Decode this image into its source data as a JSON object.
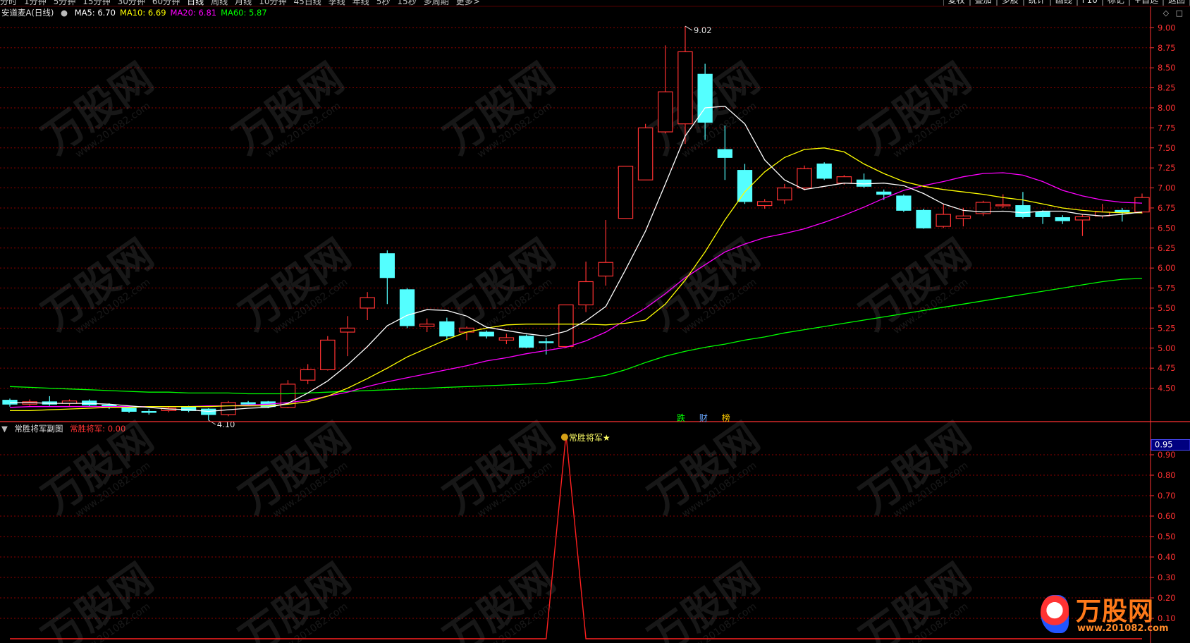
{
  "toolbar": {
    "periods": [
      "分时",
      "1分钟",
      "5分钟",
      "15分钟",
      "30分钟",
      "60分钟",
      "日线",
      "周线",
      "月线",
      "10分钟",
      "45日线",
      "季线",
      "年线",
      "5秒",
      "15秒",
      "多周期",
      "更多>"
    ],
    "active_period": "日线",
    "right_buttons": [
      "复权",
      "叠加",
      "多股",
      "统计",
      "画线",
      "F10",
      "标记",
      "+自选",
      "返回"
    ]
  },
  "main": {
    "stock_title": "安道麦A(日线)",
    "ma": [
      {
        "label": "MA5: 6.70",
        "color": "#ffffff"
      },
      {
        "label": "MA10: 6.69",
        "color": "#ffff00"
      },
      {
        "label": "MA20: 6.81",
        "color": "#ff00ff"
      },
      {
        "label": "MA60: 5.87",
        "color": "#00ff00"
      }
    ],
    "max_label": "9.02",
    "min_label": "4.10",
    "price_axis": [
      "9.00",
      "8.75",
      "8.50",
      "8.25",
      "8.00",
      "7.75",
      "7.50",
      "7.25",
      "7.00",
      "6.75",
      "6.50",
      "6.25",
      "6.00",
      "5.75",
      "5.50",
      "5.25",
      "5.00",
      "4.75",
      "4.50"
    ],
    "bottom_badges": [
      "跌",
      "财",
      "榜"
    ],
    "colors": {
      "up": "#ff3232",
      "down": "#54ffff",
      "grid": "#8b0000",
      "axis": "#ff3232"
    }
  },
  "sub": {
    "title": "常胜将军副图",
    "value_label": "常胜将军: 0.00",
    "signal_label": "常胜将军★",
    "current_value": "0.95",
    "axis": [
      "0.90",
      "0.80",
      "0.70",
      "0.60",
      "0.50",
      "0.40",
      "0.30",
      "0.20",
      "0.10"
    ]
  },
  "watermark": {
    "brand": "万股网",
    "url": "www.201082.com"
  },
  "chart_data": {
    "type": "candlestick",
    "candles": [
      {
        "o": 4.35,
        "c": 4.3,
        "h": 4.37,
        "l": 4.27
      },
      {
        "o": 4.3,
        "c": 4.33,
        "h": 4.36,
        "l": 4.28
      },
      {
        "o": 4.33,
        "c": 4.3,
        "h": 4.4,
        "l": 4.28
      },
      {
        "o": 4.31,
        "c": 4.34,
        "h": 4.36,
        "l": 4.28
      },
      {
        "o": 4.34,
        "c": 4.29,
        "h": 4.36,
        "l": 4.27
      },
      {
        "o": 4.29,
        "c": 4.26,
        "h": 4.31,
        "l": 4.24
      },
      {
        "o": 4.25,
        "c": 4.21,
        "h": 4.28,
        "l": 4.19
      },
      {
        "o": 4.21,
        "c": 4.2,
        "h": 4.24,
        "l": 4.17
      },
      {
        "o": 4.22,
        "c": 4.25,
        "h": 4.27,
        "l": 4.2
      },
      {
        "o": 4.27,
        "c": 4.22,
        "h": 4.28,
        "l": 4.2
      },
      {
        "o": 4.24,
        "c": 4.17,
        "h": 4.25,
        "l": 4.1
      },
      {
        "o": 4.17,
        "c": 4.32,
        "h": 4.34,
        "l": 4.15
      },
      {
        "o": 4.32,
        "c": 4.3,
        "h": 4.34,
        "l": 4.28
      },
      {
        "o": 4.33,
        "c": 4.27,
        "h": 4.34,
        "l": 4.25
      },
      {
        "o": 4.26,
        "c": 4.55,
        "h": 4.6,
        "l": 4.25
      },
      {
        "o": 4.6,
        "c": 4.73,
        "h": 4.8,
        "l": 4.55
      },
      {
        "o": 4.73,
        "c": 5.1,
        "h": 5.15,
        "l": 4.72
      },
      {
        "o": 5.2,
        "c": 5.25,
        "h": 5.4,
        "l": 4.9
      },
      {
        "o": 5.5,
        "c": 5.63,
        "h": 5.7,
        "l": 5.35
      },
      {
        "o": 6.18,
        "c": 5.88,
        "h": 6.22,
        "l": 5.55
      },
      {
        "o": 5.73,
        "c": 5.28,
        "h": 5.75,
        "l": 5.25
      },
      {
        "o": 5.27,
        "c": 5.3,
        "h": 5.37,
        "l": 5.2
      },
      {
        "o": 5.33,
        "c": 5.15,
        "h": 5.38,
        "l": 5.1
      },
      {
        "o": 5.2,
        "c": 5.25,
        "h": 5.27,
        "l": 5.1
      },
      {
        "o": 5.2,
        "c": 5.15,
        "h": 5.22,
        "l": 5.12
      },
      {
        "o": 5.1,
        "c": 5.13,
        "h": 5.18,
        "l": 5.05
      },
      {
        "o": 5.15,
        "c": 5.01,
        "h": 5.17,
        "l": 5.0
      },
      {
        "o": 5.08,
        "c": 5.07,
        "h": 5.13,
        "l": 4.92
      },
      {
        "o": 5.02,
        "c": 5.54,
        "h": 5.54,
        "l": 5.0
      },
      {
        "o": 5.54,
        "c": 5.83,
        "h": 6.08,
        "l": 5.45
      },
      {
        "o": 5.9,
        "c": 6.07,
        "h": 6.6,
        "l": 5.78
      },
      {
        "o": 6.62,
        "c": 7.27,
        "h": 7.27,
        "l": 6.62
      },
      {
        "o": 7.1,
        "c": 7.75,
        "h": 7.8,
        "l": 7.1
      },
      {
        "o": 7.7,
        "c": 8.2,
        "h": 8.78,
        "l": 7.68
      },
      {
        "o": 7.8,
        "c": 8.7,
        "h": 9.02,
        "l": 7.55
      },
      {
        "o": 8.42,
        "c": 7.82,
        "h": 8.55,
        "l": 7.6
      },
      {
        "o": 7.48,
        "c": 7.38,
        "h": 7.78,
        "l": 7.1
      },
      {
        "o": 7.22,
        "c": 6.83,
        "h": 7.3,
        "l": 6.8
      },
      {
        "o": 6.78,
        "c": 6.83,
        "h": 6.86,
        "l": 6.74
      },
      {
        "o": 6.85,
        "c": 7.0,
        "h": 7.05,
        "l": 6.8
      },
      {
        "o": 7.0,
        "c": 7.24,
        "h": 7.28,
        "l": 6.97
      },
      {
        "o": 7.3,
        "c": 7.12,
        "h": 7.32,
        "l": 7.1
      },
      {
        "o": 7.06,
        "c": 7.14,
        "h": 7.16,
        "l": 7.04
      },
      {
        "o": 7.1,
        "c": 7.02,
        "h": 7.18,
        "l": 7.0
      },
      {
        "o": 6.95,
        "c": 6.92,
        "h": 6.98,
        "l": 6.85
      },
      {
        "o": 6.9,
        "c": 6.72,
        "h": 6.92,
        "l": 6.7
      },
      {
        "o": 6.72,
        "c": 6.5,
        "h": 6.74,
        "l": 6.49
      },
      {
        "o": 6.52,
        "c": 6.67,
        "h": 6.8,
        "l": 6.5
      },
      {
        "o": 6.62,
        "c": 6.65,
        "h": 6.75,
        "l": 6.52
      },
      {
        "o": 6.68,
        "c": 6.82,
        "h": 6.84,
        "l": 6.65
      },
      {
        "o": 6.78,
        "c": 6.79,
        "h": 6.92,
        "l": 6.75
      },
      {
        "o": 6.78,
        "c": 6.64,
        "h": 6.95,
        "l": 6.62
      },
      {
        "o": 6.7,
        "c": 6.64,
        "h": 6.72,
        "l": 6.55
      },
      {
        "o": 6.63,
        "c": 6.59,
        "h": 6.66,
        "l": 6.55
      },
      {
        "o": 6.6,
        "c": 6.64,
        "h": 6.67,
        "l": 6.4
      },
      {
        "o": 6.65,
        "c": 6.7,
        "h": 6.8,
        "l": 6.62
      },
      {
        "o": 6.72,
        "c": 6.7,
        "h": 6.75,
        "l": 6.58
      },
      {
        "o": 6.7,
        "c": 6.88,
        "h": 6.93,
        "l": 6.68
      }
    ],
    "ma5_series": [
      4.32,
      4.32,
      4.31,
      4.31,
      4.31,
      4.3,
      4.28,
      4.26,
      4.24,
      4.23,
      4.21,
      4.23,
      4.25,
      4.26,
      4.31,
      4.44,
      4.59,
      4.79,
      5.02,
      5.28,
      5.41,
      5.48,
      5.47,
      5.4,
      5.26,
      5.22,
      5.18,
      5.15,
      5.21,
      5.34,
      5.52,
      5.98,
      6.46,
      7.05,
      7.65,
      8.0,
      8.02,
      7.8,
      7.35,
      7.1,
      6.98,
      7.02,
      7.06,
      7.05,
      7.06,
      7.03,
      6.93,
      6.8,
      6.72,
      6.7,
      6.71,
      6.69,
      6.71,
      6.71,
      6.67,
      6.65,
      6.67,
      6.7
    ],
    "ma10_series": [
      4.22,
      4.22,
      4.23,
      4.24,
      4.25,
      4.26,
      4.26,
      4.27,
      4.27,
      4.27,
      4.27,
      4.28,
      4.28,
      4.28,
      4.3,
      4.33,
      4.4,
      4.5,
      4.62,
      4.75,
      4.89,
      5.0,
      5.11,
      5.2,
      5.25,
      5.29,
      5.3,
      5.3,
      5.3,
      5.3,
      5.29,
      5.31,
      5.35,
      5.55,
      5.85,
      6.2,
      6.6,
      6.95,
      7.2,
      7.38,
      7.48,
      7.5,
      7.45,
      7.3,
      7.18,
      7.08,
      7.02,
      6.98,
      6.95,
      6.92,
      6.88,
      6.85,
      6.8,
      6.75,
      6.72,
      6.7,
      6.69,
      6.69
    ],
    "ma20_series": [
      4.26,
      4.27,
      4.27,
      4.27,
      4.27,
      4.27,
      4.27,
      4.27,
      4.27,
      4.27,
      4.28,
      4.28,
      4.29,
      4.3,
      4.32,
      4.35,
      4.4,
      4.45,
      4.52,
      4.58,
      4.63,
      4.68,
      4.73,
      4.78,
      4.84,
      4.88,
      4.93,
      4.97,
      5.01,
      5.09,
      5.2,
      5.35,
      5.5,
      5.68,
      5.88,
      6.04,
      6.2,
      6.3,
      6.38,
      6.43,
      6.49,
      6.57,
      6.66,
      6.76,
      6.87,
      6.97,
      7.03,
      7.08,
      7.14,
      7.18,
      7.19,
      7.16,
      7.08,
      6.97,
      6.9,
      6.85,
      6.82,
      6.81
    ],
    "ma60_series": [
      4.52,
      4.51,
      4.5,
      4.49,
      4.48,
      4.47,
      4.46,
      4.45,
      4.45,
      4.44,
      4.44,
      4.44,
      4.43,
      4.43,
      4.43,
      4.44,
      4.45,
      4.46,
      4.47,
      4.48,
      4.49,
      4.5,
      4.51,
      4.52,
      4.53,
      4.54,
      4.55,
      4.56,
      4.59,
      4.62,
      4.66,
      4.73,
      4.82,
      4.9,
      4.96,
      5.01,
      5.05,
      5.1,
      5.14,
      5.19,
      5.23,
      5.27,
      5.31,
      5.35,
      5.39,
      5.43,
      5.47,
      5.51,
      5.55,
      5.59,
      5.63,
      5.67,
      5.71,
      5.75,
      5.79,
      5.83,
      5.86,
      5.87
    ],
    "ylim": [
      4.1,
      9.1
    ],
    "sub_series": [
      0,
      0,
      0,
      0,
      0,
      0,
      0,
      0,
      0,
      0,
      0,
      0,
      0,
      0,
      0,
      0,
      0,
      0,
      0,
      0,
      0,
      0,
      0,
      0,
      0,
      0,
      0,
      0,
      1,
      0,
      0,
      0,
      0,
      0,
      0,
      0,
      0,
      0,
      0,
      0,
      0,
      0,
      0,
      0,
      0,
      0,
      0,
      0,
      0,
      0,
      0,
      0,
      0,
      0,
      0,
      0,
      0,
      0
    ],
    "sub_ylim": [
      0,
      1.0
    ]
  }
}
